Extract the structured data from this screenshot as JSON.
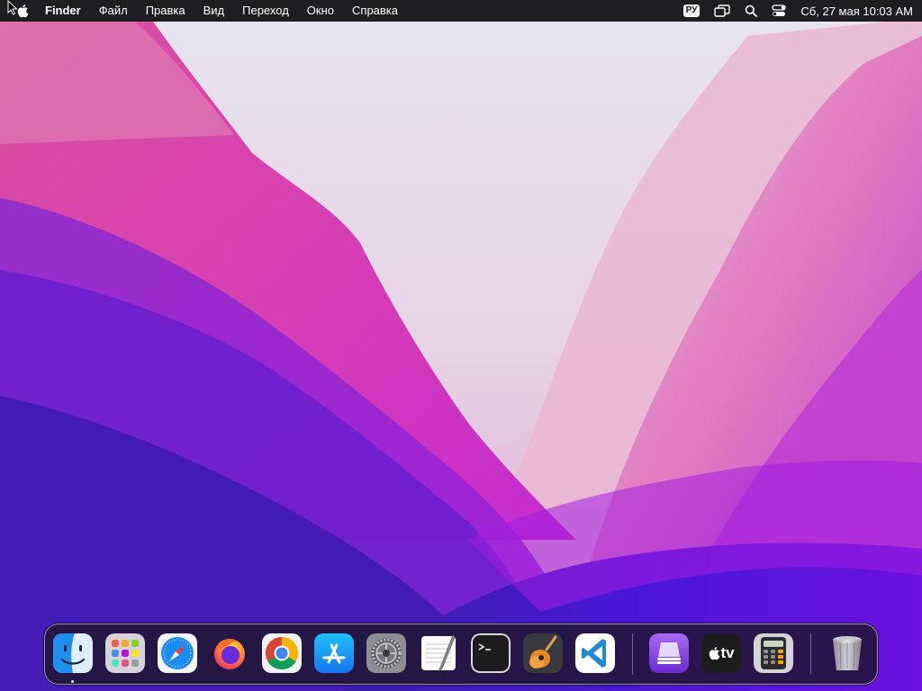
{
  "menubar": {
    "apple_icon": "apple-logo-icon",
    "app_name": "Finder",
    "items": [
      "Файл",
      "Правка",
      "Вид",
      "Переход",
      "Окно",
      "Справка"
    ],
    "input_language": "РУ",
    "status_icons": [
      "screen-mirroring-icon",
      "spotlight-search-icon",
      "control-center-icon"
    ],
    "clock": "Сб, 27 мая  10:03 AM"
  },
  "dock": {
    "apps": [
      {
        "name": "Finder",
        "icon": "finder-icon",
        "running": true
      },
      {
        "name": "Launchpad",
        "icon": "launchpad-icon",
        "running": false
      },
      {
        "name": "Safari",
        "icon": "safari-icon",
        "running": false
      },
      {
        "name": "Firefox",
        "icon": "firefox-icon",
        "running": false
      },
      {
        "name": "Google Chrome",
        "icon": "chrome-icon",
        "running": false
      },
      {
        "name": "App Store",
        "icon": "app-store-icon",
        "running": false
      },
      {
        "name": "System Settings",
        "icon": "system-settings-icon",
        "running": false
      },
      {
        "name": "TextEdit",
        "icon": "textedit-icon",
        "running": false
      },
      {
        "name": "Terminal",
        "icon": "terminal-icon",
        "running": false
      },
      {
        "name": "GarageBand",
        "icon": "garageband-icon",
        "running": false
      },
      {
        "name": "Visual Studio Code",
        "icon": "vscode-icon",
        "running": false
      },
      {
        "name": "Apple Configurator",
        "icon": "configurator-icon",
        "running": false
      },
      {
        "name": "Apple TV",
        "icon": "apple-tv-icon",
        "running": false
      },
      {
        "name": "Calculator",
        "icon": "calculator-icon",
        "running": false
      },
      {
        "name": "Trash",
        "icon": "trash-icon",
        "running": false
      }
    ],
    "tv_label": "tv"
  },
  "colors": {
    "menubar_bg": "#1e1d22",
    "wallpaper_top": "#e6dcef",
    "wallpaper_pink": "#d43aa8",
    "wallpaper_purple": "#5a17c8"
  }
}
